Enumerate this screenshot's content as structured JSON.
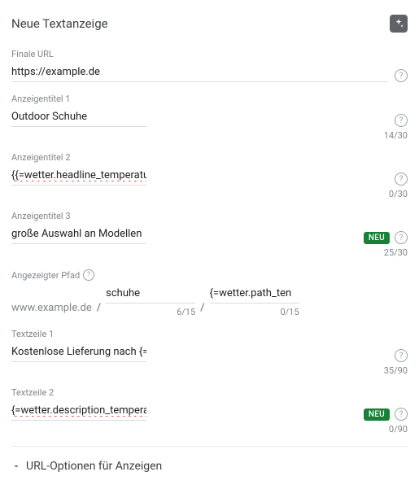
{
  "header": {
    "title": "Neue Textanzeige"
  },
  "finalUrl": {
    "label": "Finale URL",
    "value": "https://example.de"
  },
  "headline1": {
    "label": "Anzeigentitel 1",
    "value": "Outdoor Schuhe",
    "counter": "14/30"
  },
  "headline2": {
    "label": "Anzeigentitel 2",
    "value": "{{=wetter.headline_temperatur_max}}",
    "counter": "0/30"
  },
  "headline3": {
    "label": "Anzeigentitel 3",
    "value": "große Auswahl an Modellen",
    "counter": "25/30",
    "badge": "NEU"
  },
  "displayPath": {
    "label": "Angezeigter Pfad",
    "domain": "www.example.de",
    "path1": {
      "value": "schuhe",
      "counter": "6/15"
    },
    "path2": {
      "value": "{=wetter.path_ten",
      "counter": "0/15"
    }
  },
  "description1": {
    "label": "Textzeile 1",
    "value": "Kostenlose Lieferung nach {=wetter.City} möglich.",
    "counter": "35/90"
  },
  "description2": {
    "label": "Textzeile 2",
    "value": "{=wetter.description_temperatur_max}",
    "counter": "0/90",
    "badge": "NEU"
  },
  "accordion": {
    "label": "URL-Optionen für Anzeigen"
  }
}
